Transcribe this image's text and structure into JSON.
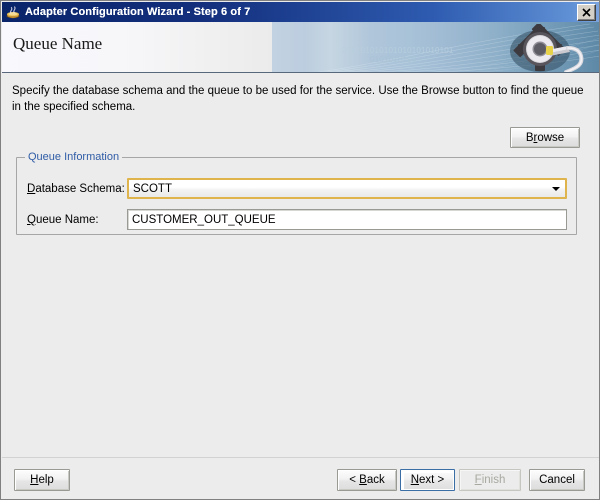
{
  "window": {
    "title": "Adapter Configuration Wizard - Step 6 of 7",
    "icon": "wizard-cup-icon",
    "close_label": "✕"
  },
  "banner": {
    "heading": "Queue Name",
    "decoration_icon": "gear-wrench-icon",
    "binary_row1": "010101010101010101010101",
    "binary_row2": "0101010100"
  },
  "main": {
    "description": "Specify the database schema and the queue to be used for the service. Use the Browse button to find the queue in the specified schema.",
    "browse": {
      "label_before": "B",
      "mnemonic": "r",
      "label_after": "owse"
    },
    "group": {
      "title": "Queue Information",
      "schema": {
        "mnemonic": "D",
        "label_after": "atabase Schema:",
        "value": "SCOTT"
      },
      "queue": {
        "mnemonic": "Q",
        "label_after": "ueue Name:",
        "value": "CUSTOMER_OUT_QUEUE"
      }
    }
  },
  "footer": {
    "help": {
      "before": "",
      "mnemonic": "H",
      "after": "elp"
    },
    "back": {
      "before": "< ",
      "mnemonic": "B",
      "after": "ack"
    },
    "next": {
      "before": "",
      "mnemonic": "N",
      "after": "ext >"
    },
    "finish": {
      "before": "",
      "mnemonic": "F",
      "after": "inish"
    },
    "cancel": {
      "before": "",
      "mnemonic": "",
      "after": "Cancel"
    }
  },
  "colors": {
    "titlebar_start": "#0a246a",
    "titlebar_end": "#7ba4df",
    "group_title": "#2f5ca6",
    "combo_focus_border": "#e0b44c",
    "default_button_focus": "#3a6ea5",
    "window_background": "#ececec"
  }
}
